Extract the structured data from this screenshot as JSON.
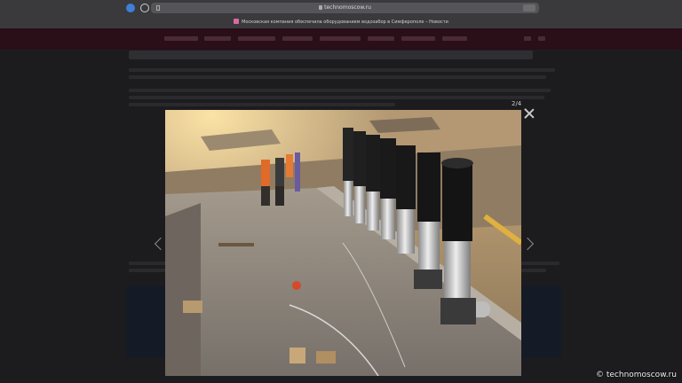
{
  "browser": {
    "url": "technomoscow.ru",
    "tab_title": "Московская компания обеспечила оборудованием водозабор в Симферополе – Новости"
  },
  "lightbox": {
    "counter": "2/4"
  },
  "watermark": {
    "text": "© technomoscow.ru"
  },
  "icons": [
    "shield-icon",
    "vpn-icon",
    "lock-icon",
    "close-icon",
    "chevron-left-icon",
    "chevron-right-icon"
  ],
  "colors": {
    "nav_bar": "#2a0e18",
    "page_bg": "#1c1c1f",
    "browser_chrome": "#3a3a3d"
  }
}
